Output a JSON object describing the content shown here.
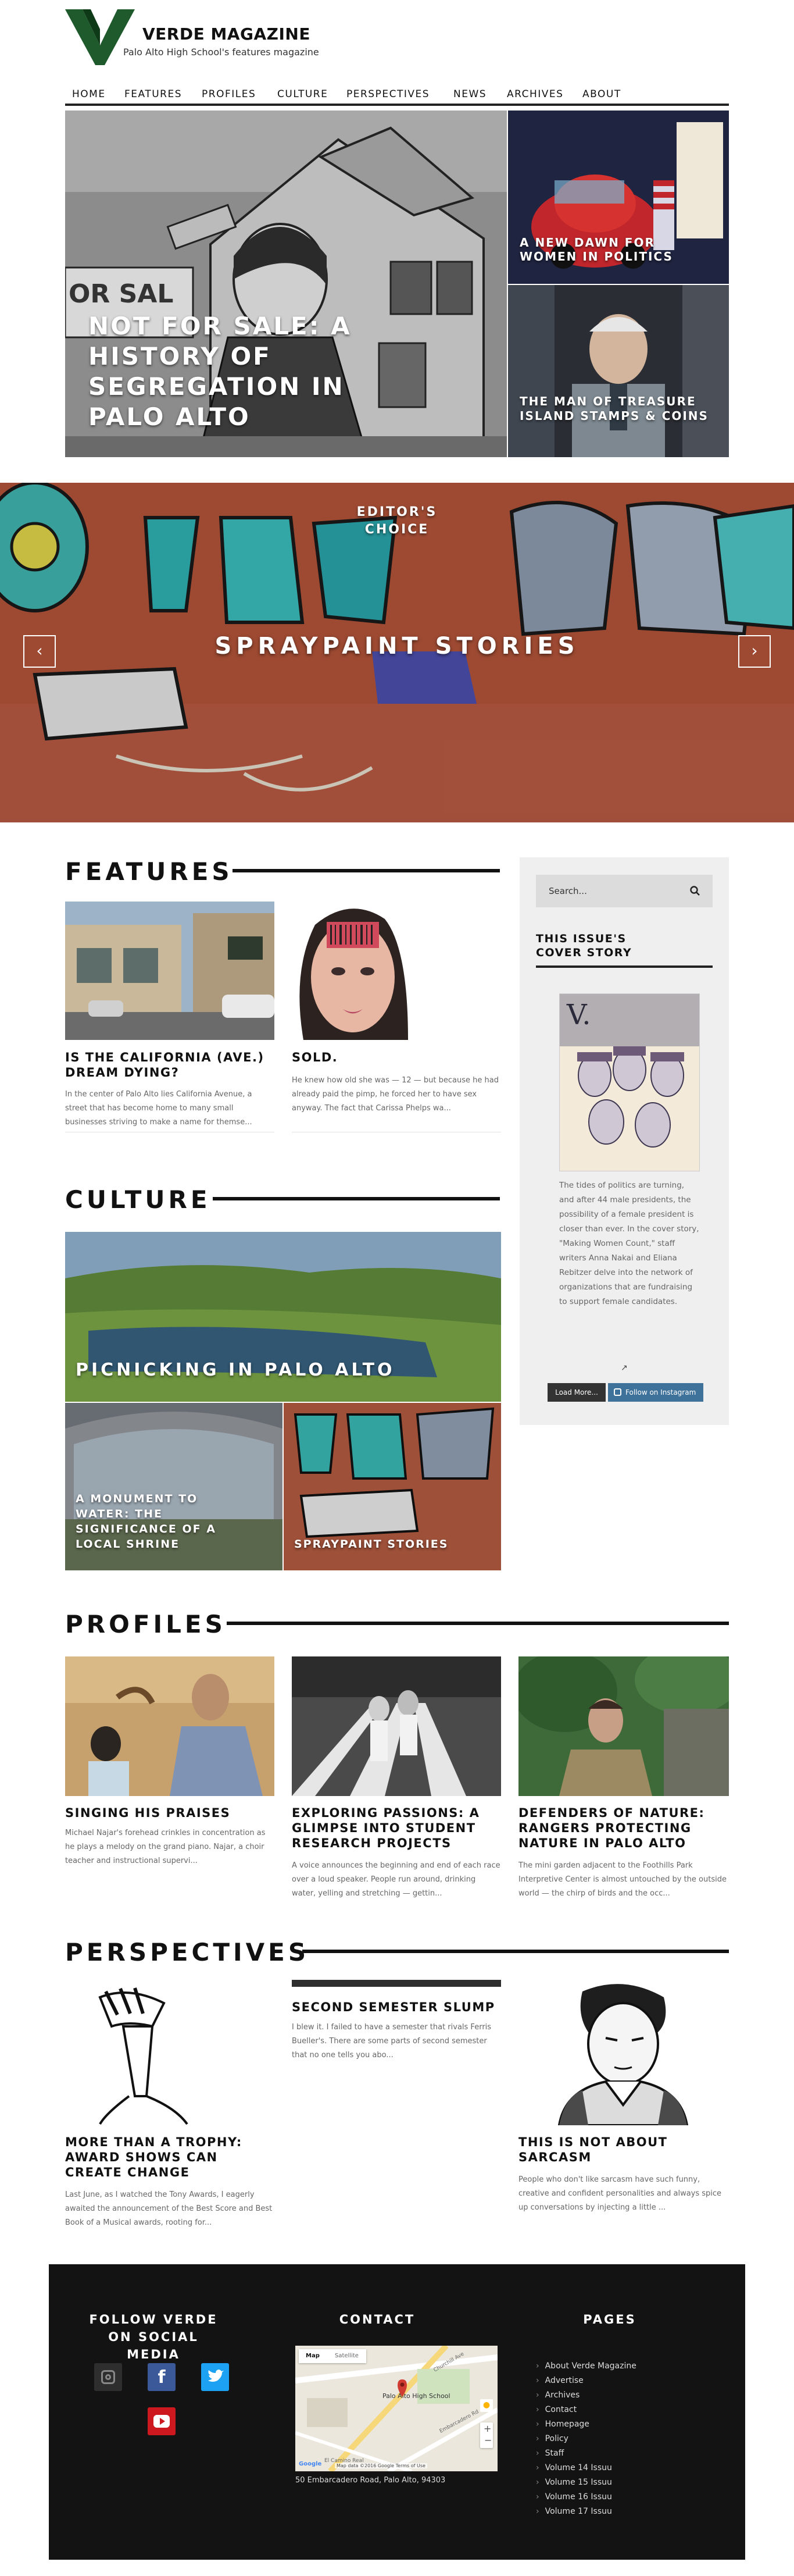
{
  "site": {
    "title": "VERDE MAGAZINE",
    "tagline": "Palo Alto High School's features magazine"
  },
  "nav": [
    "HOME",
    "FEATURES",
    "PROFILES",
    "CULTURE",
    "PERSPECTIVES",
    "NEWS",
    "ARCHIVES",
    "ABOUT"
  ],
  "hero": {
    "main_title": "NOT FOR SALE: A HISTORY OF SEGREGATION IN PALO ALTO",
    "top_right_title": "A NEW DAWN FOR WOMEN IN POLITICS",
    "bottom_right_title": "THE MAN OF TREASURE ISLAND STAMPS & COINS"
  },
  "slider": {
    "kicker": "EDITOR'S CHOICE",
    "title": "SPRAYPAINT STORIES",
    "prev_icon": "chevron-left-icon",
    "next_icon": "chevron-right-icon"
  },
  "features": {
    "heading": "FEATURES",
    "cards": [
      {
        "title": "IS THE CALIFORNIA (AVE.) DREAM DYING?",
        "excerpt": "In the center of Palo Alto lies California Avenue, a street that has become home to many small businesses striving to make a name for themse..."
      },
      {
        "title": "SOLD.",
        "excerpt": "He knew how old she was — 12 — but because he had already paid the pimp, he forced her to have sex anyway. The fact that Carissa Phelps wa..."
      }
    ]
  },
  "sidebar": {
    "search_placeholder": "Search...",
    "cover_heading": "THIS ISSUE'S COVER STORY",
    "cover_text": "The tides of politics are turning, and after 44 male presidents, the possibility of a female president is closer than ever. In the cover story, \"Making Women Count,\" staff writers Anna Nakai and Eliana Rebitzer delve into the network of organizations that are fundraising to support female candidates.",
    "load_more": "Load More...",
    "follow_instagram": "Follow on Instagram"
  },
  "culture": {
    "heading": "CULTURE",
    "big_title": "PICNICKING IN PALO ALTO",
    "left_title": "A MONUMENT TO WATER: THE SIGNIFICANCE OF A LOCAL SHRINE",
    "right_title": "SPRAYPAINT STORIES"
  },
  "profiles": {
    "heading": "PROFILES",
    "cards": [
      {
        "title": "SINGING HIS PRAISES",
        "excerpt": "Michael Najar's forehead crinkles in concentration as he plays a melody on the grand piano. Najar, a choir teacher and instructional supervi..."
      },
      {
        "title": "EXPLORING PASSIONS: A GLIMPSE INTO STUDENT RESEARCH PROJECTS",
        "excerpt": "A voice announces the beginning and end of each race over a loud speaker. People run around, drinking water, yelling and stretching — gettin..."
      },
      {
        "title": "DEFENDERS OF NATURE: RANGERS PROTECTING NATURE IN PALO ALTO",
        "excerpt": "The mini garden adjacent to the Foothills Park Interpretive Center is almost untouched by the outside world — the chirp of birds and the occ..."
      }
    ]
  },
  "perspectives": {
    "heading": "PERSPECTIVES",
    "cards": [
      {
        "title": "MORE THAN A TROPHY: AWARD SHOWS CAN CREATE CHANGE",
        "excerpt": "Last June, as I watched the Tony Awards, I eagerly awaited the announcement of the Best Score and Best Book of a Musical awards, rooting for..."
      },
      {
        "title": "SECOND SEMESTER SLUMP",
        "excerpt": "I blew it. I failed to have a semester that rivals Ferris Bueller's. There are some parts of second semester that no one tells you abo..."
      },
      {
        "title": "THIS IS NOT ABOUT SARCASM",
        "excerpt": "People who don't like sarcasm have such funny, creative and confident personalities and always spice up conversations by injecting a little ..."
      }
    ]
  },
  "footer": {
    "social_heading": "FOLLOW VERDE ON SOCIAL MEDIA",
    "contact_heading": "CONTACT",
    "pages_heading": "PAGES",
    "map_tabs": [
      "Map",
      "Satellite"
    ],
    "map_label": "Palo Alto High School",
    "map_footer": "Map data ©2016 Google   Terms of Use",
    "map_street_1": "Churchill Ave",
    "map_street_2": "El Camino Real",
    "map_street_3": "Embarcadero Rd",
    "map_brand": "Google",
    "address": "50 Embarcadero Road, Palo Alto, 94303",
    "pages": [
      "About Verde Magazine",
      "Advertise",
      "Archives",
      "Contact",
      "Homepage",
      "Policy",
      "Staff",
      "Volume 14 Issuu",
      "Volume 15 Issuu",
      "Volume 16 Issuu",
      "Volume 17 Issuu"
    ]
  },
  "colors": {
    "brand_green": "#1f5a2c",
    "dark": "#131313",
    "instagram_blue": "#3f729b",
    "facebook_blue": "#3b5998",
    "twitter_blue": "#1da1f2",
    "youtube_red": "#cc181e"
  }
}
